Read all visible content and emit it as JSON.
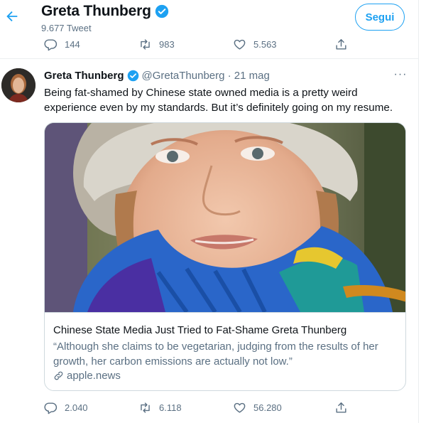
{
  "header": {
    "back_icon": "arrow-left-icon",
    "name": "Greta Thunberg",
    "tweet_count": "9.677 Tweet",
    "follow_label": "Segui"
  },
  "prev_actions": {
    "reply": "144",
    "retweet": "983",
    "like": "5.563"
  },
  "tweet": {
    "name": "Greta Thunberg",
    "handle_date": "@GretaThunberg · 21 mag",
    "more": "···",
    "text": "Being fat-shamed by Chinese state owned media is a pretty weird\nexperience even by my standards. But it’s definitely going on my resume.",
    "card": {
      "title": "Chinese State Media Just Tried to Fat-Shame Greta Thunberg",
      "description": "“Although she claims to be vegetarian, judging from the results of her growth, her carbon emissions are actually not low.”",
      "domain": "apple.news"
    },
    "actions": {
      "reply": "2.040",
      "retweet": "6.118",
      "like": "56.280"
    }
  },
  "colors": {
    "accent": "#1da1f2",
    "secondary": "#5b7083",
    "border": "#cfd9de"
  }
}
